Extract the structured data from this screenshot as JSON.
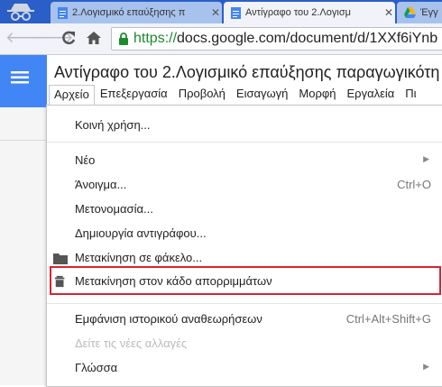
{
  "browser": {
    "tabs": [
      {
        "title": "2.Λογισμικό επαύξησης π",
        "active": false
      },
      {
        "title": "Αντίγραφο του 2.Λογισμ",
        "active": true
      },
      {
        "title": "Έγγ",
        "active": false
      }
    ],
    "url_scheme": "https://",
    "url_rest": "docs.google.com/document/d/1XXf6iYnb"
  },
  "doc": {
    "title": "Αντίγραφο του 2.Λογισμικό επαύξησης παραγωγικότη"
  },
  "menubar": [
    "Αρχείο",
    "Επεξεργασία",
    "Προβολή",
    "Εισαγωγή",
    "Μορφή",
    "Εργαλεία",
    "Πι"
  ],
  "file_menu": {
    "share": "Κοινή χρήση...",
    "new": "Νέο",
    "open": "Άνοιγμα...",
    "open_shortcut": "Ctrl+O",
    "rename": "Μετονομασία...",
    "make_copy": "Δημιουργία αντιγράφου...",
    "move_to_folder": "Μετακίνηση σε φάκελο...",
    "move_to_trash": "Μετακίνηση στον κάδο απορριμμάτων",
    "revision_history": "Εμφάνιση ιστορικού αναθεωρήσεων",
    "revision_shortcut": "Ctrl+Alt+Shift+G",
    "see_changes": "Δείτε τις νέες αλλαγές",
    "language": "Γλώσσα"
  },
  "colors": {
    "highlight": "#d42530",
    "docs_blue": "#4285f4",
    "tab_strip": "#2a5fc7"
  }
}
